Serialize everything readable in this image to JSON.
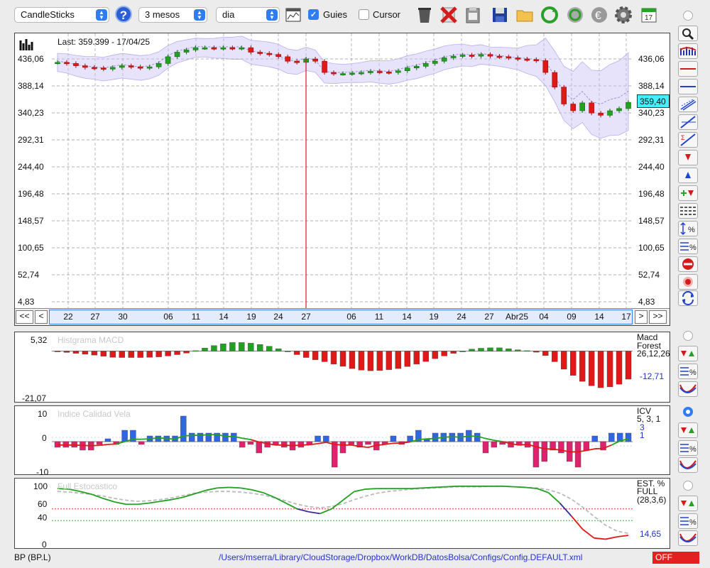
{
  "toolbar": {
    "chart_type": "CandleSticks",
    "period": "3 mesos",
    "interval": "dia",
    "guides_label": "Guies",
    "guides_checked": true,
    "cursor_label": "Cursor",
    "cursor_checked": false,
    "help_label": "?"
  },
  "main": {
    "last_label": "Last: 359.399 - 17/04/25",
    "price_tag": "359,40",
    "y_ticks": [
      "436,06",
      "388,14",
      "340,23",
      "292,31",
      "244,40",
      "196,48",
      "148,57",
      "100,65",
      "52,74",
      "4,83"
    ],
    "x_ticks": [
      "22",
      "27",
      "30",
      "06",
      "11",
      "14",
      "19",
      "24",
      "27",
      "06",
      "11",
      "14",
      "19",
      "24",
      "27",
      "Abr25",
      "04",
      "09",
      "14",
      "17"
    ],
    "nav": {
      "first": "<<",
      "prev": "<",
      "next": ">",
      "last": ">>"
    }
  },
  "macd": {
    "title": "Histgrama MACD",
    "y_top": "5,32",
    "y_bottom": "-21,07",
    "name1": "Macd",
    "name2": "Forest",
    "params": "26,12,26",
    "value": "-12,71"
  },
  "icv": {
    "title": "Indice Calidad Vela",
    "y_top": "10",
    "y_mid": "0",
    "y_bottom": "-10",
    "name": "ICV",
    "params": "5, 3, 1",
    "value1": "3",
    "value2": "1"
  },
  "stoch": {
    "title": "Full Estocastico",
    "y_ticks": [
      "100",
      "60",
      "40",
      "0"
    ],
    "name1": "EST. %",
    "name2": "FULL",
    "params": "(28,3,6)",
    "value": "14,65"
  },
  "status": {
    "ticker": "BP (BP.L)",
    "path": "/Users/mserra/Library/CloudStorage/Dropbox/WorkDB/DatosBolsa/Configs/Config.DEFAULT.xml",
    "mode": "OFF"
  },
  "colors": {
    "up": "#22a022",
    "down": "#e01818",
    "band": "#c9c2f3",
    "accent": "#2f7cf6",
    "icv_up": "#3066e0",
    "icv_down": "#e0226e"
  },
  "chart_data": [
    {
      "type": "candlestick",
      "title": "",
      "ylim": [
        4.83,
        460
      ],
      "x": [
        "22",
        "24",
        "27",
        "28",
        "29",
        "30",
        "03",
        "04",
        "05",
        "06",
        "07",
        "10",
        "11",
        "12",
        "13",
        "14",
        "17",
        "18",
        "19",
        "20",
        "21",
        "24",
        "25",
        "26",
        "27",
        "28",
        "03",
        "04",
        "05",
        "06",
        "07",
        "10",
        "11",
        "12",
        "13",
        "14",
        "17",
        "18",
        "19",
        "20",
        "21",
        "24",
        "25",
        "26",
        "27",
        "28",
        "31",
        "01",
        "02",
        "03",
        "04",
        "07",
        "08",
        "09",
        "10",
        "11",
        "14",
        "15",
        "16",
        "17"
      ],
      "close": [
        430,
        428,
        424,
        421,
        420,
        418,
        421,
        424,
        422,
        420,
        422,
        428,
        440,
        448,
        452,
        456,
        456,
        455,
        456,
        455,
        456,
        448,
        446,
        444,
        440,
        432,
        430,
        436,
        432,
        412,
        410,
        410,
        411,
        412,
        414,
        413,
        412,
        415,
        420,
        423,
        428,
        432,
        438,
        441,
        443,
        441,
        444,
        441,
        440,
        438,
        436,
        435,
        433,
        412,
        386,
        356,
        344,
        358,
        340,
        336,
        344,
        348,
        359
      ]
    },
    {
      "type": "bar",
      "title": "Histgrama MACD",
      "ylim": [
        -21.07,
        5.32
      ],
      "values": [
        -0.3,
        -0.6,
        -1,
        -1.4,
        -1.8,
        -2.3,
        -2.8,
        -2.9,
        -2.9,
        -2.9,
        -2.8,
        -2.6,
        -2.2,
        -1.6,
        -0.9,
        0.2,
        1.4,
        2.5,
        3.3,
        3.9,
        3.9,
        3.6,
        3.0,
        2.2,
        1.1,
        0,
        -1.6,
        -2.9,
        -3.9,
        -4.8,
        -5.9,
        -6.9,
        -7.9,
        -8.6,
        -8.9,
        -8.8,
        -8.4,
        -7.9,
        -7.0,
        -5.9,
        -4.7,
        -3.4,
        -2.2,
        -1.0,
        0,
        0.9,
        1.3,
        1.5,
        1.5,
        1.1,
        0.6,
        0.2,
        -0.5,
        -2,
        -4.8,
        -8.2,
        -11,
        -13.7,
        -15.7,
        -16.6,
        -16.2,
        -15,
        -12.71
      ]
    },
    {
      "type": "bar",
      "title": "Indice Calidad Vela",
      "ylim": [
        -10,
        10
      ],
      "values": [
        -2,
        -2,
        -2,
        -3,
        -3,
        -1,
        1,
        -1,
        4,
        4,
        -1,
        2,
        2,
        2,
        2,
        9,
        3,
        3,
        3,
        3,
        3,
        3,
        -2,
        -1,
        -4,
        -2,
        -1,
        -2,
        -3,
        -2,
        -1,
        2,
        2,
        -9,
        -4,
        -1,
        -2,
        -1,
        -3,
        -1,
        2,
        -1,
        2,
        4,
        1,
        3,
        3,
        3,
        3,
        4,
        3,
        -4,
        -2,
        -1,
        -2,
        -1,
        -2,
        -9,
        -7,
        -3,
        -4,
        -7,
        -9,
        -3,
        2,
        -3,
        3,
        3,
        3
      ]
    },
    {
      "type": "line",
      "title": "Full Estocastico",
      "ylim": [
        0,
        100
      ],
      "series": [
        {
          "values": [
            95,
            94,
            90,
            85,
            78,
            72,
            68,
            68,
            70,
            73,
            76,
            80,
            86,
            92,
            96,
            97,
            96,
            93,
            88,
            80,
            70,
            60,
            55,
            52,
            60,
            75,
            90,
            94,
            95,
            95,
            95,
            95,
            96,
            97,
            98,
            99,
            99,
            99,
            99,
            99,
            98,
            97,
            95,
            88,
            70,
            48,
            25,
            10,
            8,
            12,
            14.65
          ]
        },
        {
          "values": [
            90,
            89,
            87,
            85,
            82,
            78,
            75,
            73,
            74,
            76,
            79,
            83,
            87,
            89,
            90,
            90,
            89,
            87,
            84,
            79,
            74,
            68,
            64,
            62,
            64,
            69,
            76,
            82,
            87,
            90,
            92,
            94,
            95,
            96,
            97,
            98,
            98,
            98,
            99,
            99,
            98,
            97,
            96,
            93,
            87,
            77,
            63,
            47,
            32,
            22,
            18
          ]
        }
      ]
    }
  ]
}
